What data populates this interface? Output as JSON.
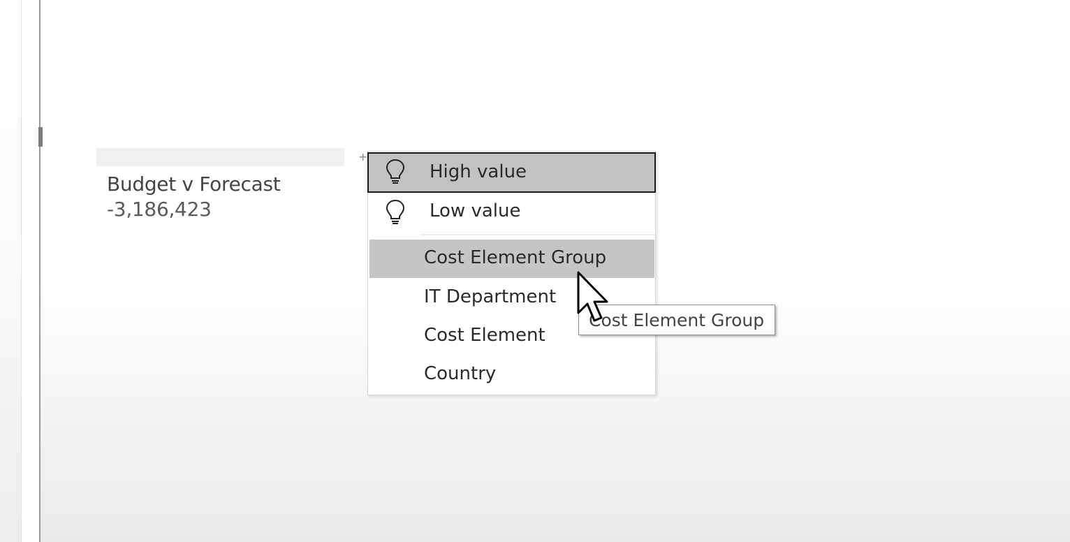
{
  "visual": {
    "title": "Budget v Forecast",
    "value": "-3,186,423",
    "header_plus": "+"
  },
  "menu": {
    "insight_items": [
      {
        "label": "High value",
        "icon": "lightbulb-icon"
      },
      {
        "label": "Low value",
        "icon": "lightbulb-icon"
      }
    ],
    "field_items": [
      {
        "label": "Cost Element Group"
      },
      {
        "label": "IT Department"
      },
      {
        "label": "Cost Element"
      },
      {
        "label": "Country"
      }
    ],
    "highlighted": "Cost Element Group"
  },
  "tooltip": {
    "text": "Cost Element Group"
  },
  "colors": {
    "hover_highlight": "#c2c2c2",
    "selected_border": "#1a1a1a",
    "menu_background": "#ffffff"
  }
}
